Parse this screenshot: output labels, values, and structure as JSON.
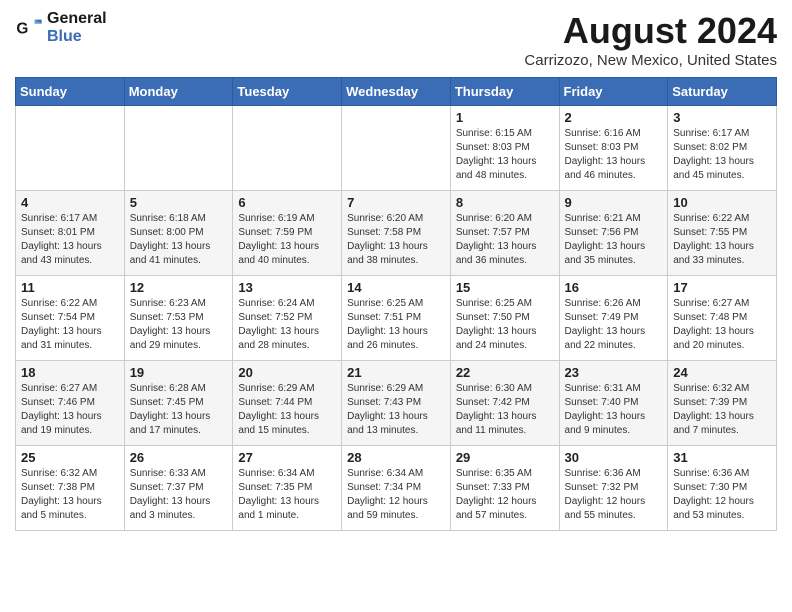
{
  "logo": {
    "line1": "General",
    "line2": "Blue"
  },
  "title": "August 2024",
  "location": "Carrizozo, New Mexico, United States",
  "weekdays": [
    "Sunday",
    "Monday",
    "Tuesday",
    "Wednesday",
    "Thursday",
    "Friday",
    "Saturday"
  ],
  "weeks": [
    [
      {
        "day": "",
        "info": ""
      },
      {
        "day": "",
        "info": ""
      },
      {
        "day": "",
        "info": ""
      },
      {
        "day": "",
        "info": ""
      },
      {
        "day": "1",
        "info": "Sunrise: 6:15 AM\nSunset: 8:03 PM\nDaylight: 13 hours\nand 48 minutes."
      },
      {
        "day": "2",
        "info": "Sunrise: 6:16 AM\nSunset: 8:03 PM\nDaylight: 13 hours\nand 46 minutes."
      },
      {
        "day": "3",
        "info": "Sunrise: 6:17 AM\nSunset: 8:02 PM\nDaylight: 13 hours\nand 45 minutes."
      }
    ],
    [
      {
        "day": "4",
        "info": "Sunrise: 6:17 AM\nSunset: 8:01 PM\nDaylight: 13 hours\nand 43 minutes."
      },
      {
        "day": "5",
        "info": "Sunrise: 6:18 AM\nSunset: 8:00 PM\nDaylight: 13 hours\nand 41 minutes."
      },
      {
        "day": "6",
        "info": "Sunrise: 6:19 AM\nSunset: 7:59 PM\nDaylight: 13 hours\nand 40 minutes."
      },
      {
        "day": "7",
        "info": "Sunrise: 6:20 AM\nSunset: 7:58 PM\nDaylight: 13 hours\nand 38 minutes."
      },
      {
        "day": "8",
        "info": "Sunrise: 6:20 AM\nSunset: 7:57 PM\nDaylight: 13 hours\nand 36 minutes."
      },
      {
        "day": "9",
        "info": "Sunrise: 6:21 AM\nSunset: 7:56 PM\nDaylight: 13 hours\nand 35 minutes."
      },
      {
        "day": "10",
        "info": "Sunrise: 6:22 AM\nSunset: 7:55 PM\nDaylight: 13 hours\nand 33 minutes."
      }
    ],
    [
      {
        "day": "11",
        "info": "Sunrise: 6:22 AM\nSunset: 7:54 PM\nDaylight: 13 hours\nand 31 minutes."
      },
      {
        "day": "12",
        "info": "Sunrise: 6:23 AM\nSunset: 7:53 PM\nDaylight: 13 hours\nand 29 minutes."
      },
      {
        "day": "13",
        "info": "Sunrise: 6:24 AM\nSunset: 7:52 PM\nDaylight: 13 hours\nand 28 minutes."
      },
      {
        "day": "14",
        "info": "Sunrise: 6:25 AM\nSunset: 7:51 PM\nDaylight: 13 hours\nand 26 minutes."
      },
      {
        "day": "15",
        "info": "Sunrise: 6:25 AM\nSunset: 7:50 PM\nDaylight: 13 hours\nand 24 minutes."
      },
      {
        "day": "16",
        "info": "Sunrise: 6:26 AM\nSunset: 7:49 PM\nDaylight: 13 hours\nand 22 minutes."
      },
      {
        "day": "17",
        "info": "Sunrise: 6:27 AM\nSunset: 7:48 PM\nDaylight: 13 hours\nand 20 minutes."
      }
    ],
    [
      {
        "day": "18",
        "info": "Sunrise: 6:27 AM\nSunset: 7:46 PM\nDaylight: 13 hours\nand 19 minutes."
      },
      {
        "day": "19",
        "info": "Sunrise: 6:28 AM\nSunset: 7:45 PM\nDaylight: 13 hours\nand 17 minutes."
      },
      {
        "day": "20",
        "info": "Sunrise: 6:29 AM\nSunset: 7:44 PM\nDaylight: 13 hours\nand 15 minutes."
      },
      {
        "day": "21",
        "info": "Sunrise: 6:29 AM\nSunset: 7:43 PM\nDaylight: 13 hours\nand 13 minutes."
      },
      {
        "day": "22",
        "info": "Sunrise: 6:30 AM\nSunset: 7:42 PM\nDaylight: 13 hours\nand 11 minutes."
      },
      {
        "day": "23",
        "info": "Sunrise: 6:31 AM\nSunset: 7:40 PM\nDaylight: 13 hours\nand 9 minutes."
      },
      {
        "day": "24",
        "info": "Sunrise: 6:32 AM\nSunset: 7:39 PM\nDaylight: 13 hours\nand 7 minutes."
      }
    ],
    [
      {
        "day": "25",
        "info": "Sunrise: 6:32 AM\nSunset: 7:38 PM\nDaylight: 13 hours\nand 5 minutes."
      },
      {
        "day": "26",
        "info": "Sunrise: 6:33 AM\nSunset: 7:37 PM\nDaylight: 13 hours\nand 3 minutes."
      },
      {
        "day": "27",
        "info": "Sunrise: 6:34 AM\nSunset: 7:35 PM\nDaylight: 13 hours\nand 1 minute."
      },
      {
        "day": "28",
        "info": "Sunrise: 6:34 AM\nSunset: 7:34 PM\nDaylight: 12 hours\nand 59 minutes."
      },
      {
        "day": "29",
        "info": "Sunrise: 6:35 AM\nSunset: 7:33 PM\nDaylight: 12 hours\nand 57 minutes."
      },
      {
        "day": "30",
        "info": "Sunrise: 6:36 AM\nSunset: 7:32 PM\nDaylight: 12 hours\nand 55 minutes."
      },
      {
        "day": "31",
        "info": "Sunrise: 6:36 AM\nSunset: 7:30 PM\nDaylight: 12 hours\nand 53 minutes."
      }
    ]
  ]
}
